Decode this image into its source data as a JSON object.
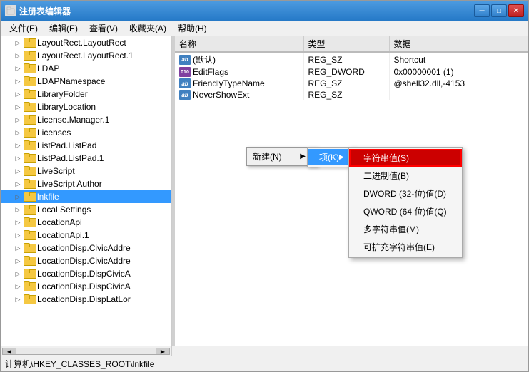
{
  "window": {
    "title": "注册表编辑器",
    "icon": "regedit"
  },
  "titlebar": {
    "buttons": {
      "minimize": "─",
      "maximize": "□",
      "close": "✕"
    }
  },
  "menu": {
    "items": [
      {
        "label": "文件(E)",
        "id": "file"
      },
      {
        "label": "编辑(E)",
        "id": "edit"
      },
      {
        "label": "查看(V)",
        "id": "view"
      },
      {
        "label": "收藏夹(A)",
        "id": "favorites"
      },
      {
        "label": "帮助(H)",
        "id": "help"
      }
    ]
  },
  "tree": {
    "items": [
      {
        "label": "LayoutRect.LayoutRect",
        "indent": 1,
        "expanded": false
      },
      {
        "label": "LayoutRect.LayoutRect.1",
        "indent": 1,
        "expanded": false
      },
      {
        "label": "LDAP",
        "indent": 1,
        "expanded": false
      },
      {
        "label": "LDAPNamespace",
        "indent": 1,
        "expanded": false
      },
      {
        "label": "LibraryFolder",
        "indent": 1,
        "expanded": false
      },
      {
        "label": "LibraryLocation",
        "indent": 1,
        "expanded": false
      },
      {
        "label": "License.Manager.1",
        "indent": 1,
        "expanded": false
      },
      {
        "label": "Licenses",
        "indent": 1,
        "expanded": false
      },
      {
        "label": "ListPad.ListPad",
        "indent": 1,
        "expanded": false
      },
      {
        "label": "ListPad.ListPad.1",
        "indent": 1,
        "expanded": false
      },
      {
        "label": "LiveScript",
        "indent": 1,
        "expanded": false
      },
      {
        "label": "LiveScript Author",
        "indent": 1,
        "expanded": false
      },
      {
        "label": "lnkfile",
        "indent": 1,
        "expanded": false,
        "selected": true
      },
      {
        "label": "Local Settings",
        "indent": 1,
        "expanded": false
      },
      {
        "label": "LocationApi",
        "indent": 1,
        "expanded": false
      },
      {
        "label": "LocationApi.1",
        "indent": 1,
        "expanded": false
      },
      {
        "label": "LocationDisp.CivicAddre",
        "indent": 1,
        "expanded": false
      },
      {
        "label": "LocationDisp.CivicAddre",
        "indent": 1,
        "expanded": false
      },
      {
        "label": "LocationDisp.DispCivicA",
        "indent": 1,
        "expanded": false
      },
      {
        "label": "LocationDisp.DispCivicA",
        "indent": 1,
        "expanded": false
      },
      {
        "label": "LocationDisp.DispLatLor",
        "indent": 1,
        "expanded": false
      }
    ]
  },
  "registry_table": {
    "headers": [
      "名称",
      "类型",
      "数据"
    ],
    "rows": [
      {
        "name": "(默认)",
        "icon": "ab",
        "type": "REG_SZ",
        "data": "Shortcut"
      },
      {
        "name": "EditFlags",
        "icon": "bits",
        "type": "REG_DWORD",
        "data": "0x00000001 (1)"
      },
      {
        "name": "FriendlyTypeName",
        "icon": "ab",
        "type": "REG_SZ",
        "data": "@shell32.dll,-4153"
      },
      {
        "name": "NeverShowExt",
        "icon": "ab",
        "type": "REG_SZ",
        "data": ""
      }
    ]
  },
  "new_button": {
    "label": "新建(N)",
    "arrow": "▶",
    "submenu_item": "项(K)",
    "submenu_arrow": "▶"
  },
  "context_menu": {
    "items": [
      {
        "label": "字符串值(S)",
        "highlighted": true
      },
      {
        "label": "二进制值(B)",
        "highlighted": false
      },
      {
        "label": "DWORD (32-位)值(D)",
        "highlighted": false
      },
      {
        "label": "QWORD (64 位)值(Q)",
        "highlighted": false
      },
      {
        "label": "多字符串值(M)",
        "highlighted": false
      },
      {
        "label": "可扩充字符串值(E)",
        "highlighted": false
      }
    ]
  },
  "status_bar": {
    "path": "计算机\\HKEY_CLASSES_ROOT\\lnkfile"
  }
}
